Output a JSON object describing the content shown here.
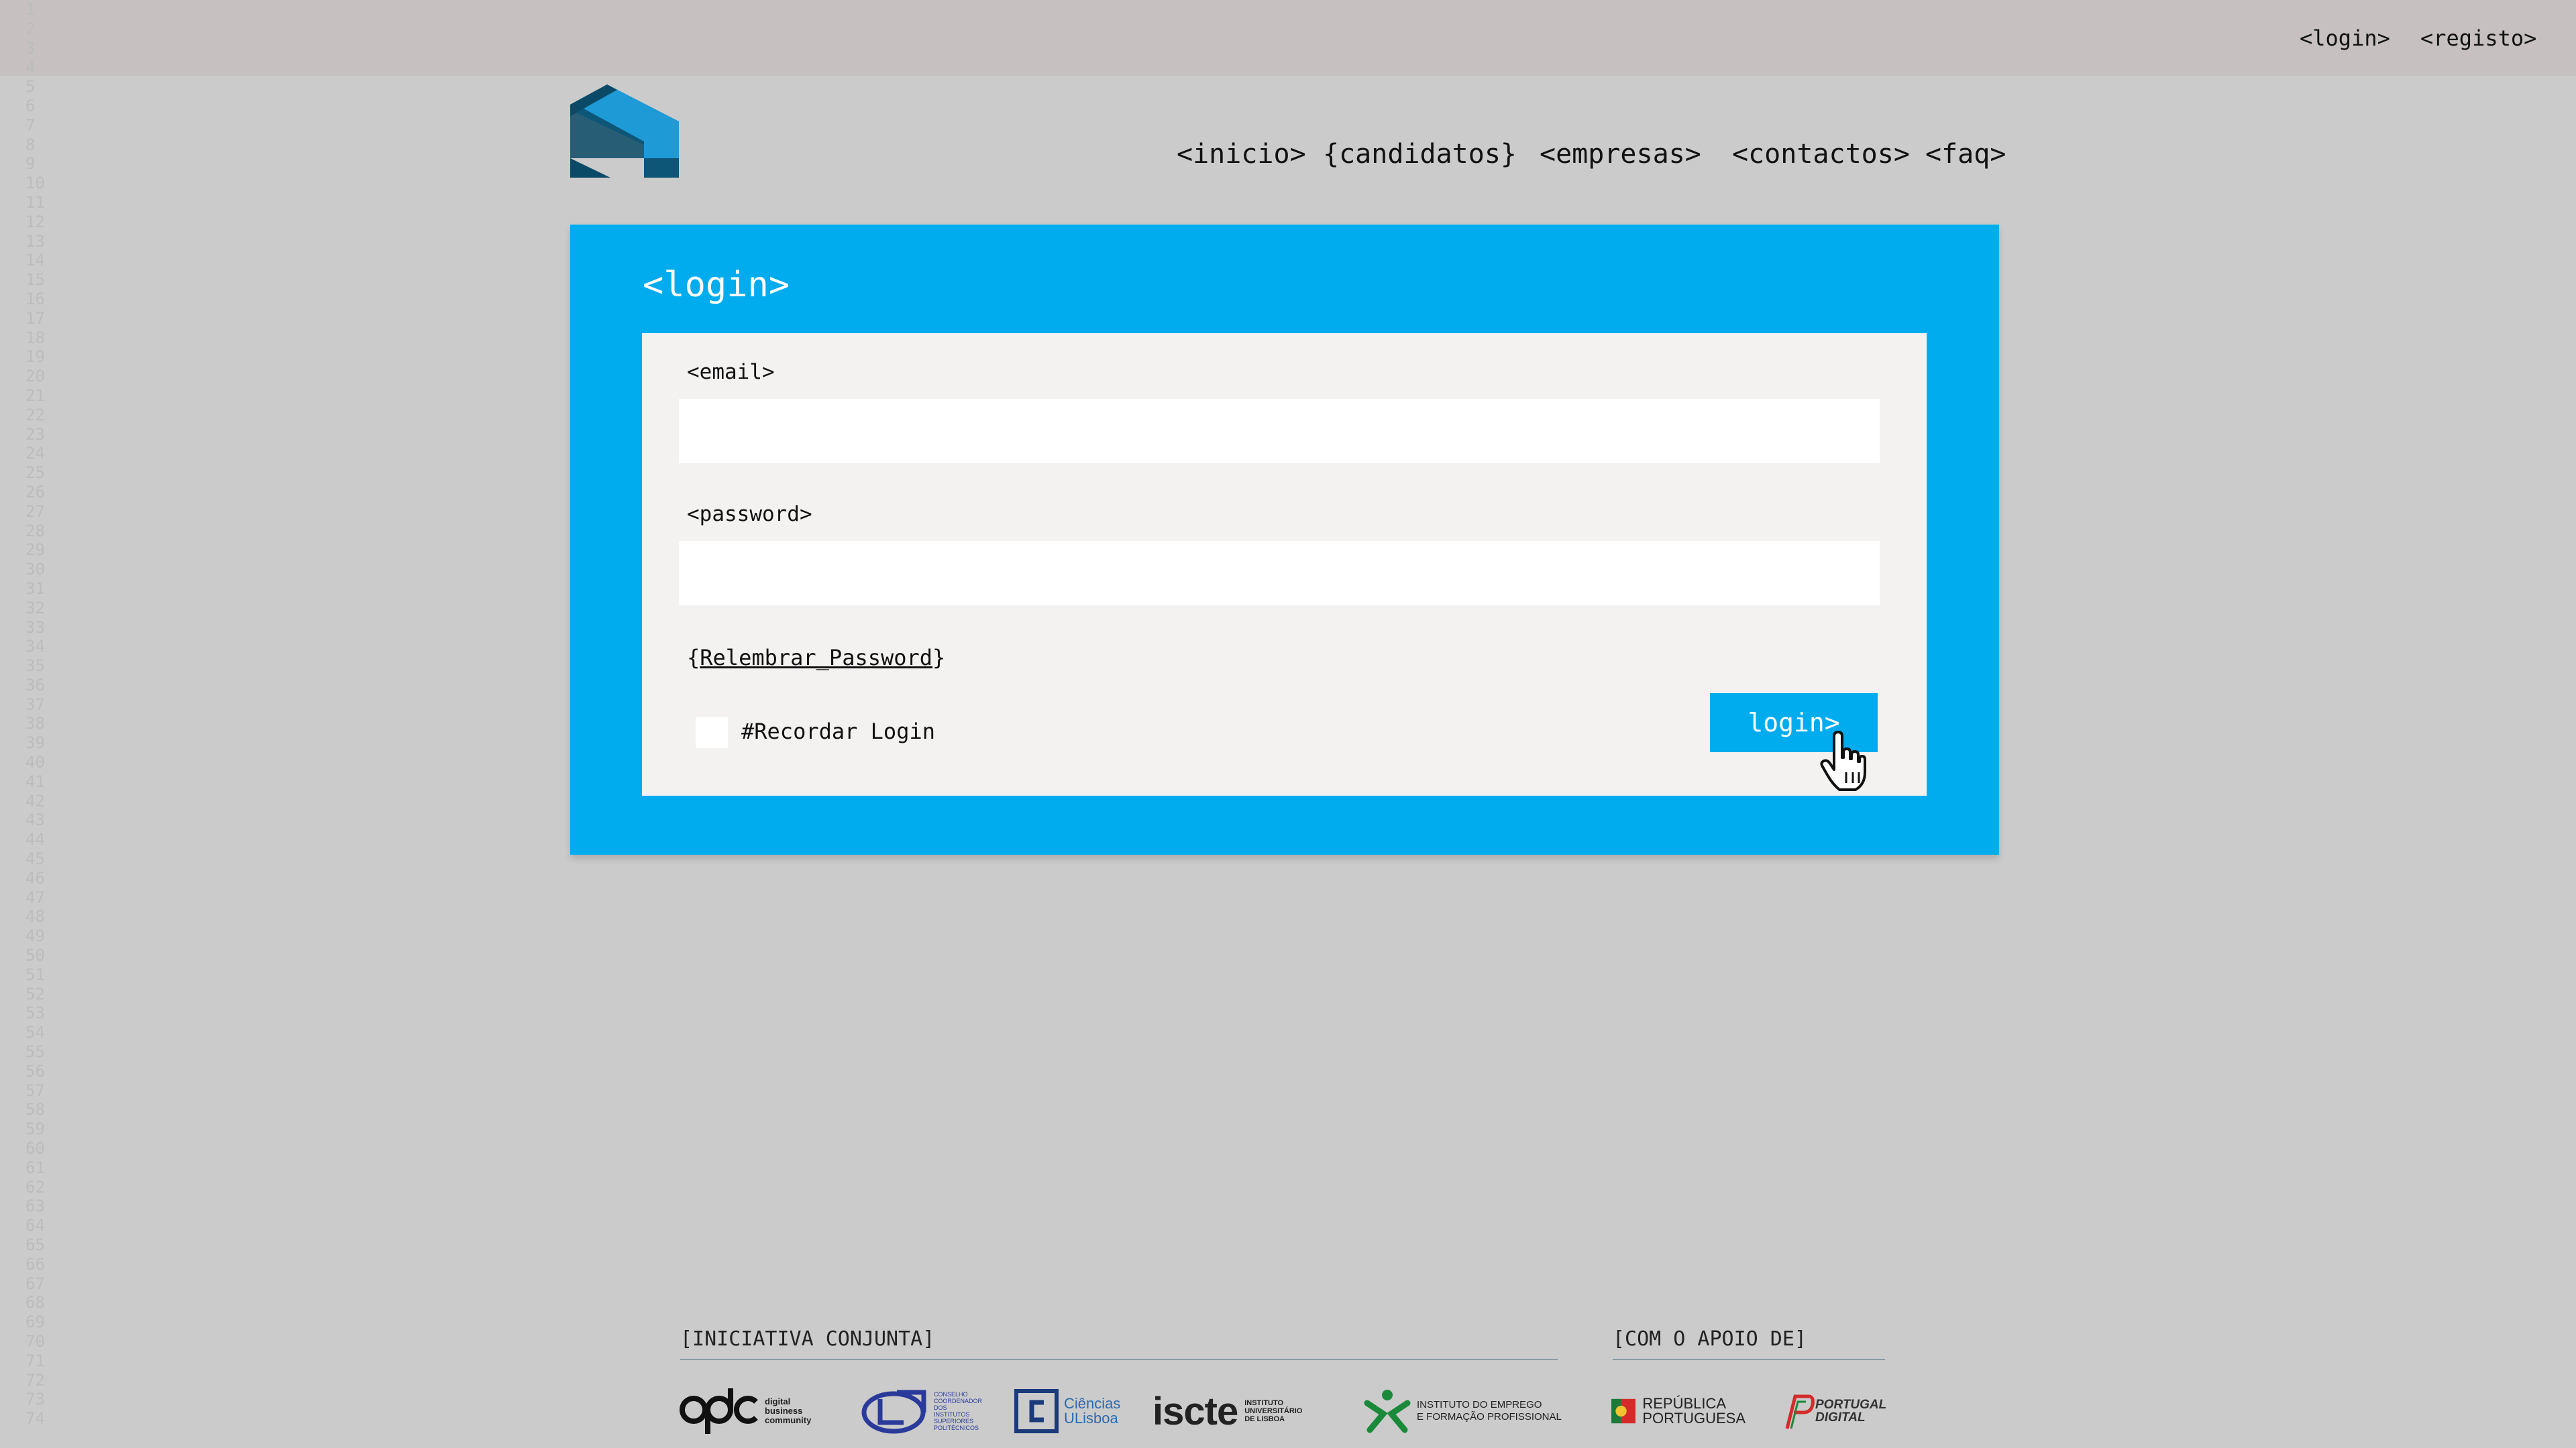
{
  "topbar": {
    "login": "<login>",
    "registo": "<registo>"
  },
  "gutter": [
    "1",
    "2",
    "3",
    "4",
    "5",
    "6",
    "7",
    "8",
    "9",
    "10",
    "11",
    "12",
    "13",
    "14",
    "15",
    "16",
    "17",
    "18",
    "19",
    "20",
    "21",
    "22",
    "23",
    "24",
    "25",
    "26",
    "27",
    "28",
    "29",
    "30",
    "31",
    "32",
    "33",
    "34",
    "35",
    "36",
    "37",
    "38",
    "39",
    "40",
    "41",
    "42",
    "43",
    "44",
    "45",
    "46",
    "47",
    "48",
    "49",
    "50",
    "51",
    "52",
    "53",
    "54",
    "55",
    "56",
    "57",
    "58",
    "59",
    "60",
    "61",
    "62",
    "63",
    "64",
    "65",
    "66",
    "67",
    "68",
    "69",
    "70",
    "71",
    "72",
    "73",
    "74"
  ],
  "nav": {
    "inicio": "<inicio>",
    "candidatos": "{candidatos}",
    "empresas": "<empresas>",
    "contactos": "<contactos>",
    "faq": "<faq>"
  },
  "login": {
    "title": "<login>",
    "email_label": "<email>",
    "email_value": "",
    "password_label": "<password>",
    "password_value": "",
    "remember_open": "{",
    "remember_link": "Relembrar_Password",
    "remember_close": "}",
    "remember_login": "#Recordar Login",
    "submit": "login>"
  },
  "footer": {
    "partners_heading": "[INICIATIVA CONJUNTA]",
    "support_heading": "[COM O APOIO DE]",
    "apdc_lines": [
      "digital",
      "business",
      "community"
    ],
    "ccisp_lines": [
      "CONSELHO",
      "COORDENADOR",
      "DOS",
      "INSTITUTOS",
      "SUPERIORES",
      "POLITÉCNICOS"
    ],
    "ciencias": [
      "Ciências",
      "ULisboa"
    ],
    "iscte": "iscte",
    "iscte_lines": [
      "INSTITUTO",
      "UNIVERSITÁRIO",
      "DE LISBOA"
    ],
    "iefp_lines": [
      "INSTITUTO DO EMPREGO",
      "E FORMAÇÃO PROFISSIONAL"
    ],
    "republica_lines": [
      "REPÚBLICA",
      "PORTUGUESA"
    ],
    "portugal_digital_lines": [
      "PORTUGAL",
      "DIGITAL"
    ]
  },
  "colors": {
    "accent": "#00acee",
    "logo_dark": "#0b4a66",
    "logo_light": "#1e9ad6"
  }
}
